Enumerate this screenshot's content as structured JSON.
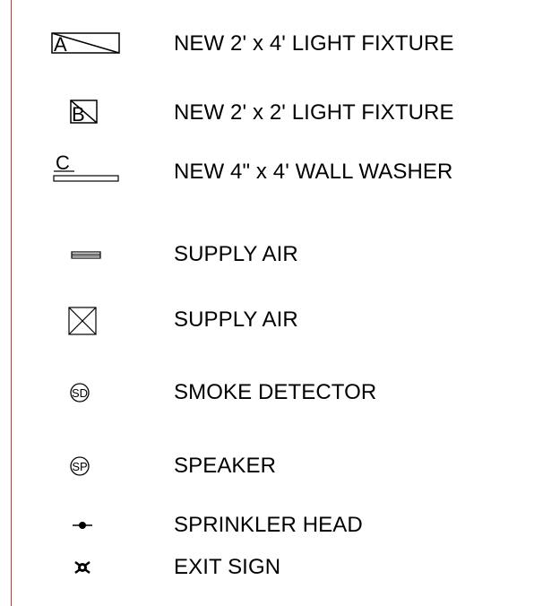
{
  "legend": {
    "items": [
      {
        "symbol": "light-fixture-2x4-icon",
        "symbol_text": "A",
        "label": "NEW 2' x 4' LIGHT FIXTURE"
      },
      {
        "symbol": "light-fixture-2x2-icon",
        "symbol_text": "B",
        "label": "NEW 2' x 2' LIGHT FIXTURE"
      },
      {
        "symbol": "wall-washer-icon",
        "symbol_text": "C",
        "label": "NEW 4\" x 4' WALL WASHER"
      },
      {
        "symbol": "linear-supply-diffuser-icon",
        "label": "SUPPLY AIR"
      },
      {
        "symbol": "square-supply-diffuser-icon",
        "label": "SUPPLY AIR"
      },
      {
        "symbol": "smoke-detector-icon",
        "symbol_text": "SD",
        "label": "SMOKE DETECTOR"
      },
      {
        "symbol": "speaker-icon",
        "symbol_text": "SP",
        "label": "SPEAKER"
      },
      {
        "symbol": "sprinkler-head-icon",
        "label": "SPRINKLER HEAD"
      },
      {
        "symbol": "exit-sign-icon",
        "label": "EXIT SIGN"
      }
    ]
  },
  "colors": {
    "ink": "#000000",
    "margin_line": "#c0392b",
    "background": "#ffffff"
  }
}
